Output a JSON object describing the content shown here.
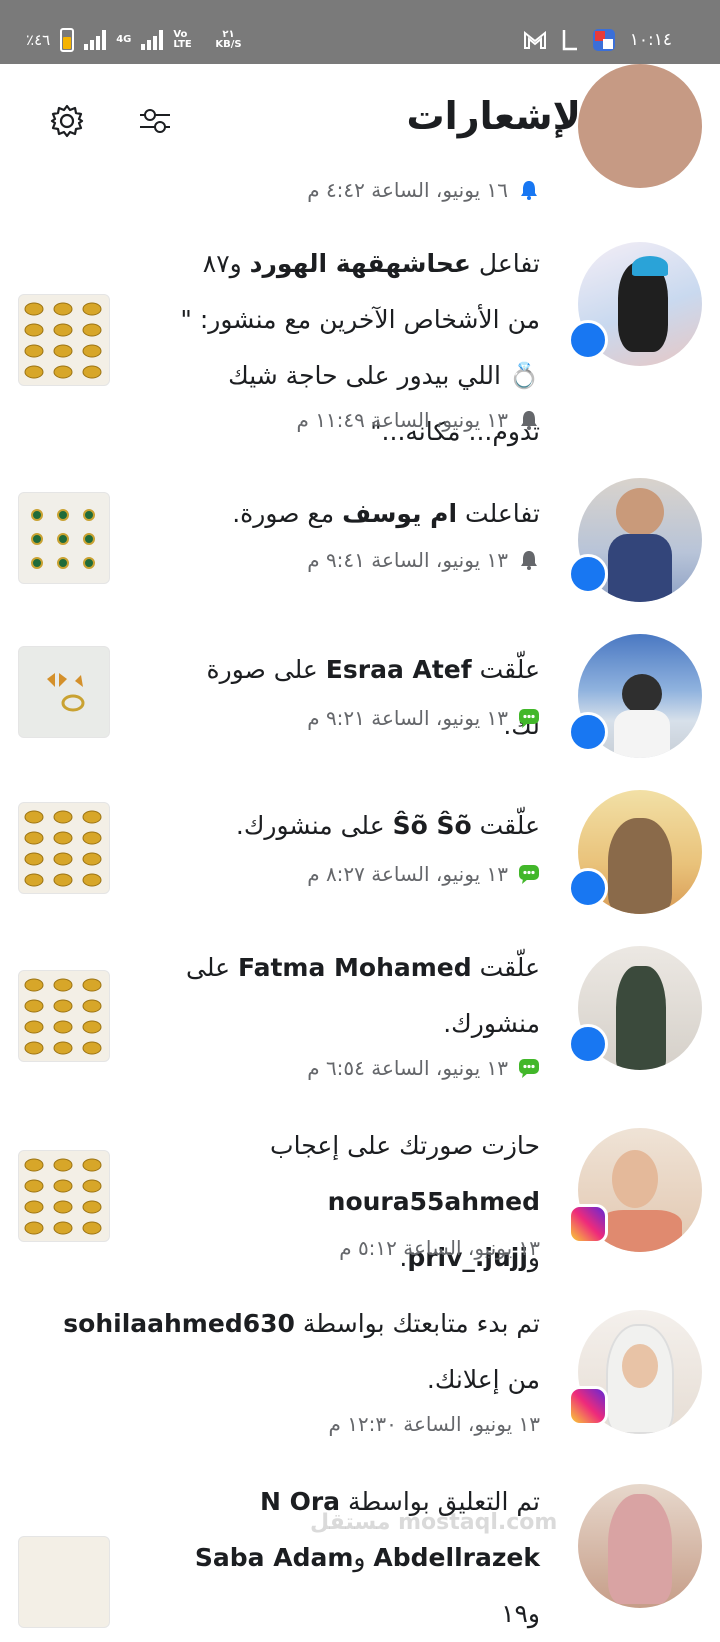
{
  "status_bar": {
    "battery_text": "٪٤٦",
    "network": "4G",
    "volte": "Vo LTE",
    "speed_value": "٢١",
    "speed_unit": "KB/S",
    "time": "١٠:١٤",
    "battery_color": "#f5b301"
  },
  "header": {
    "title": "الإشعارات",
    "back_icon": "chevron-right-icon",
    "filter_icon": "sliders-icon",
    "settings_icon": "gear-icon"
  },
  "notifications": [
    {
      "id": "n0",
      "partial": true,
      "meta": "١٦ يونيو، الساعة ٤:٤٢ م",
      "meta_icon": "bell-icon"
    },
    {
      "id": "n1",
      "platform": "facebook",
      "text_before": "تفاعل ",
      "actor": "عحاشهقهة الهورد",
      "text_after": " و٨٧ من الأشخاص الآخرين مع منشور: \" 💍 اللي بيدور على حاجة شيك تدوم... مكانه...\"",
      "meta": "١٣ يونيو، الساعة ١١:٤٩ م",
      "meta_icon": "bell-icon"
    },
    {
      "id": "n2",
      "platform": "facebook",
      "text_before": "تفاعلت ",
      "actor": "ام يوسف",
      "text_after": " مع صورة.",
      "meta": "١٣ يونيو، الساعة ٩:٤١ م",
      "meta_icon": "bell-icon"
    },
    {
      "id": "n3",
      "platform": "facebook",
      "text_before": "علّقت ",
      "actor": "Esraa Atef",
      "text_after": " على صورة لك.",
      "meta": "١٣ يونيو، الساعة ٩:٢١ م",
      "meta_icon": "comment-icon"
    },
    {
      "id": "n4",
      "platform": "facebook",
      "text_before": "علّقت ",
      "actor": "Ŝõ Ŝõ",
      "text_after": " على منشورك.",
      "meta": "١٣ يونيو، الساعة ٨:٢٧ م",
      "meta_icon": "comment-icon"
    },
    {
      "id": "n5",
      "platform": "facebook",
      "text_before": "علّقت ",
      "actor": "Fatma Mohamed",
      "text_after": " على منشورك.",
      "meta": "١٣ يونيو، الساعة ٦:٥٤ م",
      "meta_icon": "comment-icon"
    },
    {
      "id": "n6",
      "platform": "instagram",
      "text_before": "حازت صورتك على إعجاب ",
      "actor": "noura55ahmed",
      "text_mid": " و",
      "actor2": "priv_.jujj",
      "text_after": ".",
      "meta": "١٣ يونيو، الساعة ٥:١٢ م"
    },
    {
      "id": "n7",
      "platform": "instagram",
      "text_before": "تم بدء متابعتك بواسطة ",
      "actor": "sohilaahmed630",
      "text_after": " من إعلانك.",
      "meta": "١٣ يونيو، الساعة ١٢:٣٠ م"
    },
    {
      "id": "n8",
      "platform": "instagram",
      "partial": true,
      "text_before": "تم التعليق بواسطة ",
      "actor": "N Ora",
      "text_mid": " ",
      "actor2": "Abdellrazek",
      "text_mid2": " و",
      "actor3": "Saba Adam",
      "text_after": " و١٩"
    }
  ],
  "watermark": "مستقل mostaql.com"
}
